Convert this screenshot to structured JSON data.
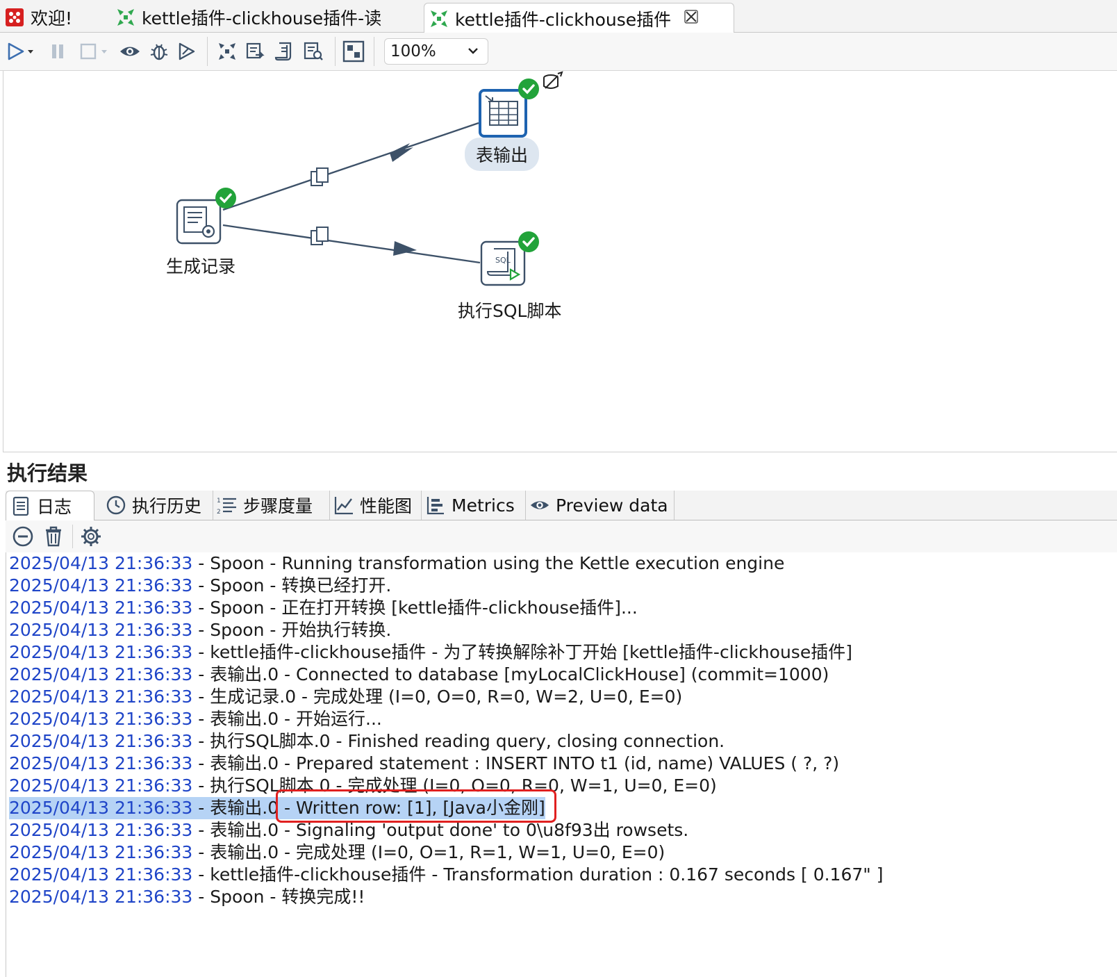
{
  "tabs": [
    {
      "label": "欢迎!"
    },
    {
      "label": "kettle插件-clickhouse插件-读"
    },
    {
      "label": "kettle插件-clickhouse插件"
    }
  ],
  "toolbar": {
    "zoom_value": "100%"
  },
  "canvas": {
    "steps": [
      {
        "label": "表输出"
      },
      {
        "label": "生成记录"
      },
      {
        "label": "执行SQL脚本"
      }
    ]
  },
  "results": {
    "title": "执行结果",
    "tabs": [
      {
        "label": "日志"
      },
      {
        "label": "执行历史"
      },
      {
        "label": "步骤度量"
      },
      {
        "label": "性能图"
      },
      {
        "label": "Metrics"
      },
      {
        "label": "Preview data"
      }
    ],
    "log": [
      {
        "ts": "2025/04/13 21:36:33",
        "msg": " - Spoon - Running transformation using the Kettle execution engine"
      },
      {
        "ts": "2025/04/13 21:36:33",
        "msg": " - Spoon - 转换已经打开."
      },
      {
        "ts": "2025/04/13 21:36:33",
        "msg": " - Spoon - 正在打开转换 [kettle插件-clickhouse插件]..."
      },
      {
        "ts": "2025/04/13 21:36:33",
        "msg": " - Spoon - 开始执行转换."
      },
      {
        "ts": "2025/04/13 21:36:33",
        "msg": " - kettle插件-clickhouse插件 - 为了转换解除补丁开始  [kettle插件-clickhouse插件]"
      },
      {
        "ts": "2025/04/13 21:36:33",
        "msg": " - 表输出.0 - Connected to database [myLocalClickHouse] (commit=1000)"
      },
      {
        "ts": "2025/04/13 21:36:33",
        "msg": " - 生成记录.0 - 完成处理 (I=0, O=0, R=0, W=2, U=0, E=0)"
      },
      {
        "ts": "2025/04/13 21:36:33",
        "msg": " - 表输出.0 - 开始运行..."
      },
      {
        "ts": "2025/04/13 21:36:33",
        "msg": " - 执行SQL脚本.0 - Finished reading query, closing connection."
      },
      {
        "ts": "2025/04/13 21:36:33",
        "msg": " - 表输出.0 - Prepared statement : INSERT INTO t1 (id, name) VALUES ( ?,  ?)"
      },
      {
        "ts": "2025/04/13 21:36:33",
        "msg": " - 执行SQL脚本.0 - 完成处理 (I=0, O=0, R=0, W=1, U=0, E=0)"
      },
      {
        "ts": "2025/04/13 21:36:33",
        "msg": " - 表输出.0 - Written row: [1], [Java小金刚]"
      },
      {
        "ts": "2025/04/13 21:36:33",
        "msg": " - 表输出.0 - Signaling 'output done' to 0\\u8f93出 rowsets."
      },
      {
        "ts": "2025/04/13 21:36:33",
        "msg": " - 表输出.0 - 完成处理 (I=0, O=1, R=1, W=1, U=0, E=0)"
      },
      {
        "ts": "2025/04/13 21:36:33",
        "msg": " - kettle插件-clickhouse插件 - Transformation duration : 0.167 seconds [  0.167\" ]"
      },
      {
        "ts": "2025/04/13 21:36:33",
        "msg": " - Spoon - 转换完成!!"
      }
    ]
  },
  "colors": {
    "timestamp": "#1f45c8",
    "highlight": "#b6d3f5",
    "annotation_box": "#e02020",
    "success": "#22a33a",
    "hop": "#3d5168"
  }
}
